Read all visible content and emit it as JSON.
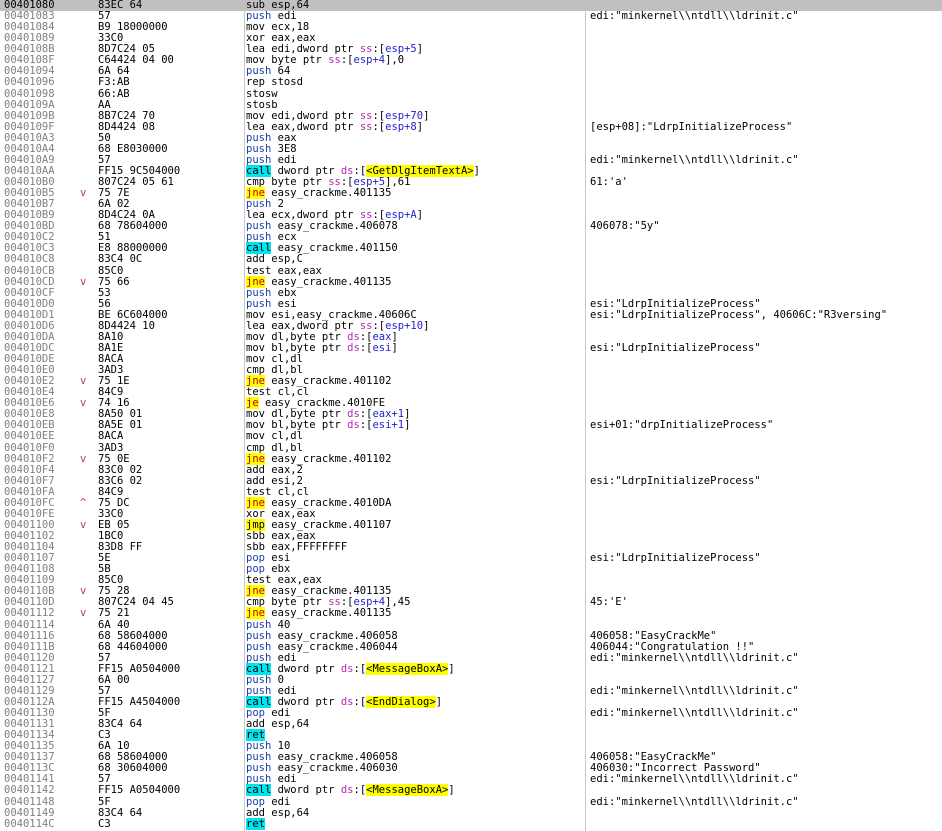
{
  "rows": [
    {
      "addr": "00401080",
      "bytes": "83EC 64",
      "arrow": "",
      "m": "sub",
      "mt": "default",
      "ops": "esp,64",
      "cmt": "",
      "sel": true
    },
    {
      "addr": "00401083",
      "bytes": "57",
      "arrow": "",
      "m": "push",
      "mt": "push",
      "ops": "edi",
      "cmt": "edi:\"minkernel\\\\ntdll\\\\ldrinit.c\""
    },
    {
      "addr": "00401084",
      "bytes": "B9 18000000",
      "arrow": "",
      "m": "mov",
      "mt": "default",
      "ops": "ecx,18",
      "cmt": ""
    },
    {
      "addr": "00401089",
      "bytes": "33C0",
      "arrow": "",
      "m": "xor",
      "mt": "default",
      "ops": "eax,eax",
      "cmt": ""
    },
    {
      "addr": "0040108B",
      "bytes": "8D7C24 05",
      "arrow": "",
      "m": "lea",
      "mt": "default",
      "ops": "edi,dword ptr ss:[esp+5]",
      "cmt": ""
    },
    {
      "addr": "0040108F",
      "bytes": "C64424 04 00",
      "arrow": "",
      "m": "mov",
      "mt": "default",
      "ops": "byte ptr ss:[esp+4],0",
      "cmt": ""
    },
    {
      "addr": "00401094",
      "bytes": "6A 64",
      "arrow": "",
      "m": "push",
      "mt": "push",
      "ops": "64",
      "cmt": ""
    },
    {
      "addr": "00401096",
      "bytes": "F3:AB",
      "arrow": "",
      "m": "rep stosd",
      "mt": "default",
      "ops": "",
      "cmt": ""
    },
    {
      "addr": "00401098",
      "bytes": "66:AB",
      "arrow": "",
      "m": "stosw",
      "mt": "default",
      "ops": "",
      "cmt": ""
    },
    {
      "addr": "0040109A",
      "bytes": "AA",
      "arrow": "",
      "m": "stosb",
      "mt": "default",
      "ops": "",
      "cmt": ""
    },
    {
      "addr": "0040109B",
      "bytes": "8B7C24 70",
      "arrow": "",
      "m": "mov",
      "mt": "default",
      "ops": "edi,dword ptr ss:[esp+70]",
      "cmt": ""
    },
    {
      "addr": "0040109F",
      "bytes": "8D4424 08",
      "arrow": "",
      "m": "lea",
      "mt": "default",
      "ops": "eax,dword ptr ss:[esp+8]",
      "cmt": "[esp+08]:\"LdrpInitializeProcess\""
    },
    {
      "addr": "004010A3",
      "bytes": "50",
      "arrow": "",
      "m": "push",
      "mt": "push",
      "ops": "eax",
      "cmt": ""
    },
    {
      "addr": "004010A4",
      "bytes": "68 E8030000",
      "arrow": "",
      "m": "push",
      "mt": "push",
      "ops": "3E8",
      "cmt": ""
    },
    {
      "addr": "004010A9",
      "bytes": "57",
      "arrow": "",
      "m": "push",
      "mt": "push",
      "ops": "edi",
      "cmt": "edi:\"minkernel\\\\ntdll\\\\ldrinit.c\""
    },
    {
      "addr": "004010AA",
      "bytes": "FF15 9C504000",
      "arrow": "",
      "m": "call",
      "mt": "call",
      "ops": "dword ptr ds:[<GetDlgItemTextA>]",
      "cmt": ""
    },
    {
      "addr": "004010B0",
      "bytes": "807C24 05 61",
      "arrow": "",
      "m": "cmp",
      "mt": "default",
      "ops": "byte ptr ss:[esp+5],61",
      "cmt": "61:'a'"
    },
    {
      "addr": "004010B5",
      "bytes": "75 7E",
      "arrow": "v",
      "m": "jne",
      "mt": "jcc",
      "ops": "easy_crackme.401135",
      "cmt": ""
    },
    {
      "addr": "004010B7",
      "bytes": "6A 02",
      "arrow": "",
      "m": "push",
      "mt": "push",
      "ops": "2",
      "cmt": ""
    },
    {
      "addr": "004010B9",
      "bytes": "8D4C24 0A",
      "arrow": "",
      "m": "lea",
      "mt": "default",
      "ops": "ecx,dword ptr ss:[esp+A]",
      "cmt": ""
    },
    {
      "addr": "004010BD",
      "bytes": "68 78604000",
      "arrow": "",
      "m": "push",
      "mt": "push",
      "ops": "easy_crackme.406078",
      "cmt": "406078:\"5y\""
    },
    {
      "addr": "004010C2",
      "bytes": "51",
      "arrow": "",
      "m": "push",
      "mt": "push",
      "ops": "ecx",
      "cmt": ""
    },
    {
      "addr": "004010C3",
      "bytes": "E8 88000000",
      "arrow": "",
      "m": "call",
      "mt": "call",
      "ops": "easy_crackme.401150",
      "cmt": ""
    },
    {
      "addr": "004010C8",
      "bytes": "83C4 0C",
      "arrow": "",
      "m": "add",
      "mt": "default",
      "ops": "esp,C",
      "cmt": ""
    },
    {
      "addr": "004010CB",
      "bytes": "85C0",
      "arrow": "",
      "m": "test",
      "mt": "default",
      "ops": "eax,eax",
      "cmt": ""
    },
    {
      "addr": "004010CD",
      "bytes": "75 66",
      "arrow": "v",
      "m": "jne",
      "mt": "jcc",
      "ops": "easy_crackme.401135",
      "cmt": ""
    },
    {
      "addr": "004010CF",
      "bytes": "53",
      "arrow": "",
      "m": "push",
      "mt": "push",
      "ops": "ebx",
      "cmt": ""
    },
    {
      "addr": "004010D0",
      "bytes": "56",
      "arrow": "",
      "m": "push",
      "mt": "push",
      "ops": "esi",
      "cmt": "esi:\"LdrpInitializeProcess\""
    },
    {
      "addr": "004010D1",
      "bytes": "BE 6C604000",
      "arrow": "",
      "m": "mov",
      "mt": "default",
      "ops": "esi,easy_crackme.40606C",
      "cmt": "esi:\"LdrpInitializeProcess\", 40606C:\"R3versing\""
    },
    {
      "addr": "004010D6",
      "bytes": "8D4424 10",
      "arrow": "",
      "m": "lea",
      "mt": "default",
      "ops": "eax,dword ptr ss:[esp+10]",
      "cmt": ""
    },
    {
      "addr": "004010DA",
      "bytes": "8A10",
      "arrow": "",
      "m": "mov",
      "mt": "default",
      "ops": "dl,byte ptr ds:[eax]",
      "cmt": ""
    },
    {
      "addr": "004010DC",
      "bytes": "8A1E",
      "arrow": "",
      "m": "mov",
      "mt": "default",
      "ops": "bl,byte ptr ds:[esi]",
      "cmt": "esi:\"LdrpInitializeProcess\""
    },
    {
      "addr": "004010DE",
      "bytes": "8ACA",
      "arrow": "",
      "m": "mov",
      "mt": "default",
      "ops": "cl,dl",
      "cmt": ""
    },
    {
      "addr": "004010E0",
      "bytes": "3AD3",
      "arrow": "",
      "m": "cmp",
      "mt": "default",
      "ops": "dl,bl",
      "cmt": ""
    },
    {
      "addr": "004010E2",
      "bytes": "75 1E",
      "arrow": "v",
      "m": "jne",
      "mt": "jcc",
      "ops": "easy_crackme.401102",
      "cmt": ""
    },
    {
      "addr": "004010E4",
      "bytes": "84C9",
      "arrow": "",
      "m": "test",
      "mt": "default",
      "ops": "cl,cl",
      "cmt": ""
    },
    {
      "addr": "004010E6",
      "bytes": "74 16",
      "arrow": "v",
      "m": "je",
      "mt": "jcc",
      "ops": "easy_crackme.4010FE",
      "cmt": ""
    },
    {
      "addr": "004010E8",
      "bytes": "8A50 01",
      "arrow": "",
      "m": "mov",
      "mt": "default",
      "ops": "dl,byte ptr ds:[eax+1]",
      "cmt": ""
    },
    {
      "addr": "004010EB",
      "bytes": "8A5E 01",
      "arrow": "",
      "m": "mov",
      "mt": "default",
      "ops": "bl,byte ptr ds:[esi+1]",
      "cmt": "esi+01:\"drpInitializeProcess\""
    },
    {
      "addr": "004010EE",
      "bytes": "8ACA",
      "arrow": "",
      "m": "mov",
      "mt": "default",
      "ops": "cl,dl",
      "cmt": ""
    },
    {
      "addr": "004010F0",
      "bytes": "3AD3",
      "arrow": "",
      "m": "cmp",
      "mt": "default",
      "ops": "dl,bl",
      "cmt": ""
    },
    {
      "addr": "004010F2",
      "bytes": "75 0E",
      "arrow": "v",
      "m": "jne",
      "mt": "jcc",
      "ops": "easy_crackme.401102",
      "cmt": ""
    },
    {
      "addr": "004010F4",
      "bytes": "83C0 02",
      "arrow": "",
      "m": "add",
      "mt": "default",
      "ops": "eax,2",
      "cmt": ""
    },
    {
      "addr": "004010F7",
      "bytes": "83C6 02",
      "arrow": "",
      "m": "add",
      "mt": "default",
      "ops": "esi,2",
      "cmt": "esi:\"LdrpInitializeProcess\""
    },
    {
      "addr": "004010FA",
      "bytes": "84C9",
      "arrow": "",
      "m": "test",
      "mt": "default",
      "ops": "cl,cl",
      "cmt": ""
    },
    {
      "addr": "004010FC",
      "bytes": "75 DC",
      "arrow": "^",
      "m": "jne",
      "mt": "jcc",
      "ops": "easy_crackme.4010DA",
      "cmt": ""
    },
    {
      "addr": "004010FE",
      "bytes": "33C0",
      "arrow": "",
      "m": "xor",
      "mt": "default",
      "ops": "eax,eax",
      "cmt": ""
    },
    {
      "addr": "00401100",
      "bytes": "EB 05",
      "arrow": "v",
      "m": "jmp",
      "mt": "jmp",
      "ops": "easy_crackme.401107",
      "cmt": ""
    },
    {
      "addr": "00401102",
      "bytes": "1BC0",
      "arrow": "",
      "m": "sbb",
      "mt": "default",
      "ops": "eax,eax",
      "cmt": ""
    },
    {
      "addr": "00401104",
      "bytes": "83D8 FF",
      "arrow": "",
      "m": "sbb",
      "mt": "default",
      "ops": "eax,FFFFFFFF",
      "cmt": ""
    },
    {
      "addr": "00401107",
      "bytes": "5E",
      "arrow": "",
      "m": "pop",
      "mt": "push",
      "ops": "esi",
      "cmt": "esi:\"LdrpInitializeProcess\""
    },
    {
      "addr": "00401108",
      "bytes": "5B",
      "arrow": "",
      "m": "pop",
      "mt": "push",
      "ops": "ebx",
      "cmt": ""
    },
    {
      "addr": "00401109",
      "bytes": "85C0",
      "arrow": "",
      "m": "test",
      "mt": "default",
      "ops": "eax,eax",
      "cmt": ""
    },
    {
      "addr": "0040110B",
      "bytes": "75 28",
      "arrow": "v",
      "m": "jne",
      "mt": "jcc",
      "ops": "easy_crackme.401135",
      "cmt": ""
    },
    {
      "addr": "0040110D",
      "bytes": "807C24 04 45",
      "arrow": "",
      "m": "cmp",
      "mt": "default",
      "ops": "byte ptr ss:[esp+4],45",
      "cmt": "45:'E'"
    },
    {
      "addr": "00401112",
      "bytes": "75 21",
      "arrow": "v",
      "m": "jne",
      "mt": "jcc",
      "ops": "easy_crackme.401135",
      "cmt": ""
    },
    {
      "addr": "00401114",
      "bytes": "6A 40",
      "arrow": "",
      "m": "push",
      "mt": "push",
      "ops": "40",
      "cmt": ""
    },
    {
      "addr": "00401116",
      "bytes": "68 58604000",
      "arrow": "",
      "m": "push",
      "mt": "push",
      "ops": "easy_crackme.406058",
      "cmt": "406058:\"EasyCrackMe\""
    },
    {
      "addr": "0040111B",
      "bytes": "68 44604000",
      "arrow": "",
      "m": "push",
      "mt": "push",
      "ops": "easy_crackme.406044",
      "cmt": "406044:\"Congratulation !!\""
    },
    {
      "addr": "00401120",
      "bytes": "57",
      "arrow": "",
      "m": "push",
      "mt": "push",
      "ops": "edi",
      "cmt": "edi:\"minkernel\\\\ntdll\\\\ldrinit.c\""
    },
    {
      "addr": "00401121",
      "bytes": "FF15 A0504000",
      "arrow": "",
      "m": "call",
      "mt": "call",
      "ops": "dword ptr ds:[<MessageBoxA>]",
      "cmt": ""
    },
    {
      "addr": "00401127",
      "bytes": "6A 00",
      "arrow": "",
      "m": "push",
      "mt": "push",
      "ops": "0",
      "cmt": ""
    },
    {
      "addr": "00401129",
      "bytes": "57",
      "arrow": "",
      "m": "push",
      "mt": "push",
      "ops": "edi",
      "cmt": "edi:\"minkernel\\\\ntdll\\\\ldrinit.c\""
    },
    {
      "addr": "0040112A",
      "bytes": "FF15 A4504000",
      "arrow": "",
      "m": "call",
      "mt": "call",
      "ops": "dword ptr ds:[<EndDialog>]",
      "cmt": ""
    },
    {
      "addr": "00401130",
      "bytes": "5F",
      "arrow": "",
      "m": "pop",
      "mt": "push",
      "ops": "edi",
      "cmt": "edi:\"minkernel\\\\ntdll\\\\ldrinit.c\""
    },
    {
      "addr": "00401131",
      "bytes": "83C4 64",
      "arrow": "",
      "m": "add",
      "mt": "default",
      "ops": "esp,64",
      "cmt": ""
    },
    {
      "addr": "00401134",
      "bytes": "C3",
      "arrow": "",
      "m": "ret",
      "mt": "ret",
      "ops": "",
      "cmt": ""
    },
    {
      "addr": "00401135",
      "bytes": "6A 10",
      "arrow": "",
      "m": "push",
      "mt": "push",
      "ops": "10",
      "cmt": ""
    },
    {
      "addr": "00401137",
      "bytes": "68 58604000",
      "arrow": "",
      "m": "push",
      "mt": "push",
      "ops": "easy_crackme.406058",
      "cmt": "406058:\"EasyCrackMe\""
    },
    {
      "addr": "0040113C",
      "bytes": "68 30604000",
      "arrow": "",
      "m": "push",
      "mt": "push",
      "ops": "easy_crackme.406030",
      "cmt": "406030:\"Incorrect Password\""
    },
    {
      "addr": "00401141",
      "bytes": "57",
      "arrow": "",
      "m": "push",
      "mt": "push",
      "ops": "edi",
      "cmt": "edi:\"minkernel\\\\ntdll\\\\ldrinit.c\""
    },
    {
      "addr": "00401142",
      "bytes": "FF15 A0504000",
      "arrow": "",
      "m": "call",
      "mt": "call",
      "ops": "dword ptr ds:[<MessageBoxA>]",
      "cmt": ""
    },
    {
      "addr": "00401148",
      "bytes": "5F",
      "arrow": "",
      "m": "pop",
      "mt": "push",
      "ops": "edi",
      "cmt": "edi:\"minkernel\\\\ntdll\\\\ldrinit.c\""
    },
    {
      "addr": "00401149",
      "bytes": "83C4 64",
      "arrow": "",
      "m": "add",
      "mt": "default",
      "ops": "esp,64",
      "cmt": ""
    },
    {
      "addr": "0040114C",
      "bytes": "C3",
      "arrow": "",
      "m": "ret",
      "mt": "ret",
      "ops": "",
      "cmt": ""
    }
  ]
}
